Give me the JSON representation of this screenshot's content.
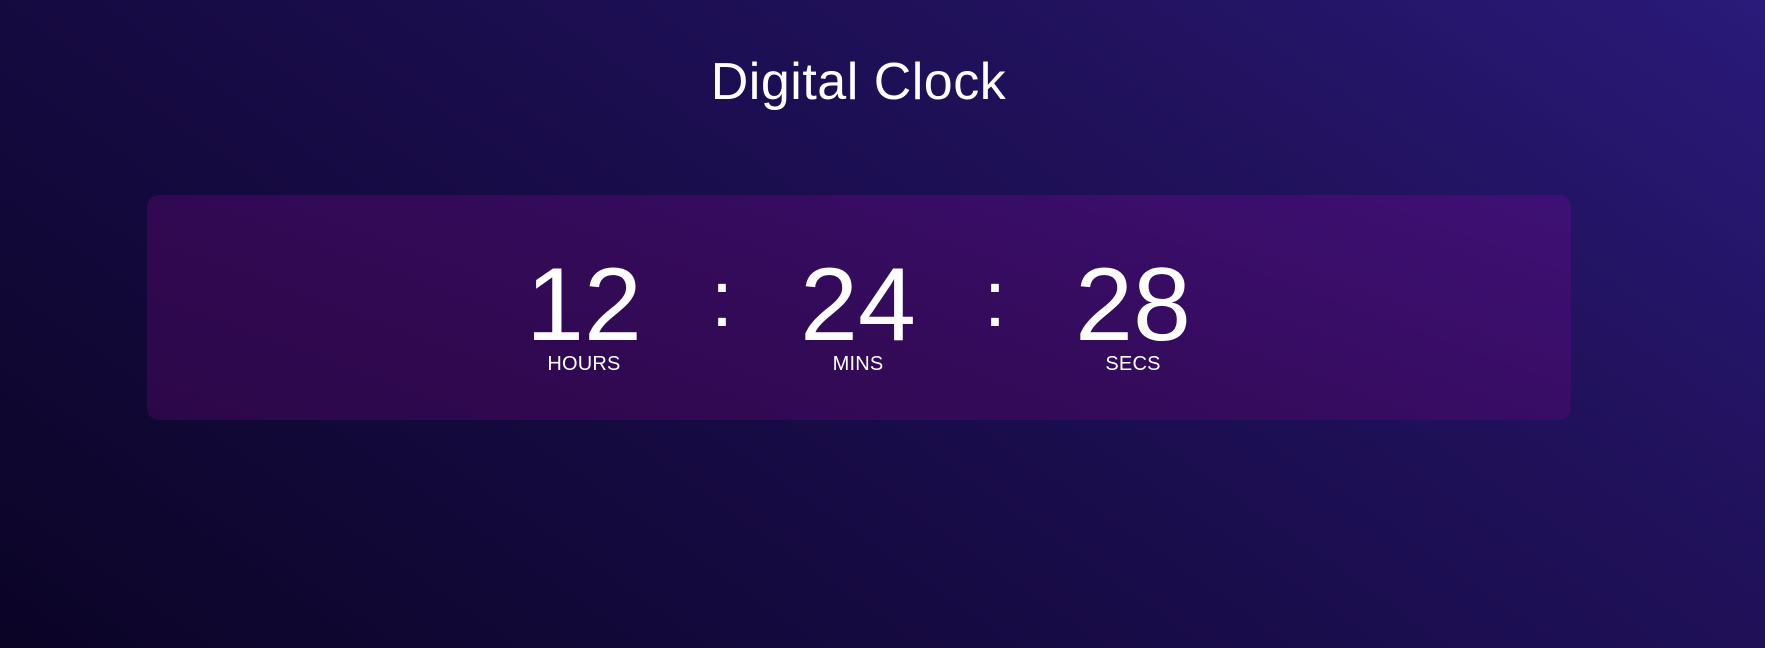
{
  "page": {
    "title": "Digital Clock"
  },
  "clock": {
    "hours": "12",
    "minutes": "24",
    "seconds": "28",
    "separator": ":",
    "labels": {
      "hours": "HOURS",
      "minutes": "MINS",
      "seconds": "SECS"
    }
  },
  "colors": {
    "background_start": "#0b0426",
    "background_end": "#2a1a7a",
    "panel_start": "#2c0748",
    "panel_end": "#3e1075",
    "text": "#ffffff"
  }
}
